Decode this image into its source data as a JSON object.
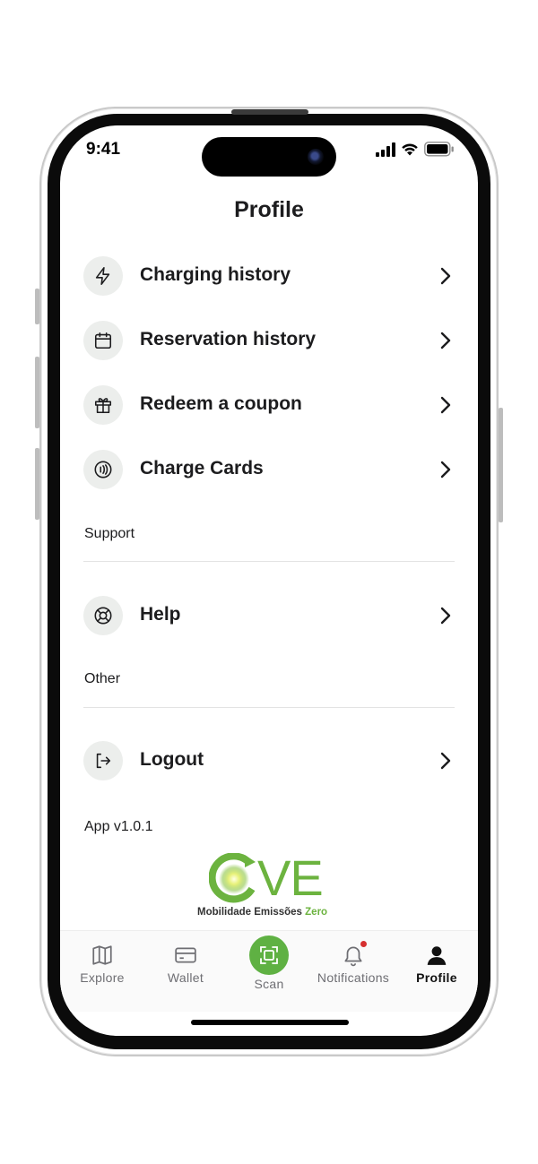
{
  "status_bar": {
    "time": "9:41"
  },
  "page": {
    "title": "Profile"
  },
  "menu": {
    "main_items": [
      {
        "label": "Charging history",
        "icon": "lightning-icon"
      },
      {
        "label": "Reservation history",
        "icon": "calendar-icon"
      },
      {
        "label": "Redeem a coupon",
        "icon": "gift-icon"
      },
      {
        "label": "Charge Cards",
        "icon": "contactless-card-icon"
      }
    ],
    "support_section": {
      "title": "Support",
      "items": [
        {
          "label": "Help",
          "icon": "lifebuoy-icon"
        }
      ]
    },
    "other_section": {
      "title": "Other",
      "items": [
        {
          "label": "Logout",
          "icon": "logout-icon"
        }
      ]
    }
  },
  "app_version": "App v1.0.1",
  "logo": {
    "letters": "VE",
    "tagline_prefix": "Mobilidade Emissões",
    "tagline_suffix": "Zero"
  },
  "tab_bar": {
    "tabs": [
      {
        "label": "Explore",
        "icon": "map-icon"
      },
      {
        "label": "Wallet",
        "icon": "wallet-card-icon"
      },
      {
        "label": "Scan",
        "icon": "scan-icon"
      },
      {
        "label": "Notifications",
        "icon": "bell-icon"
      },
      {
        "label": "Profile",
        "icon": "person-icon"
      }
    ],
    "active_tab": "Profile"
  },
  "colors": {
    "accent": "#5fb143",
    "logo_green": "#6cb33f",
    "notification_dot": "#d62f2f",
    "text": "#1c1c1e"
  }
}
